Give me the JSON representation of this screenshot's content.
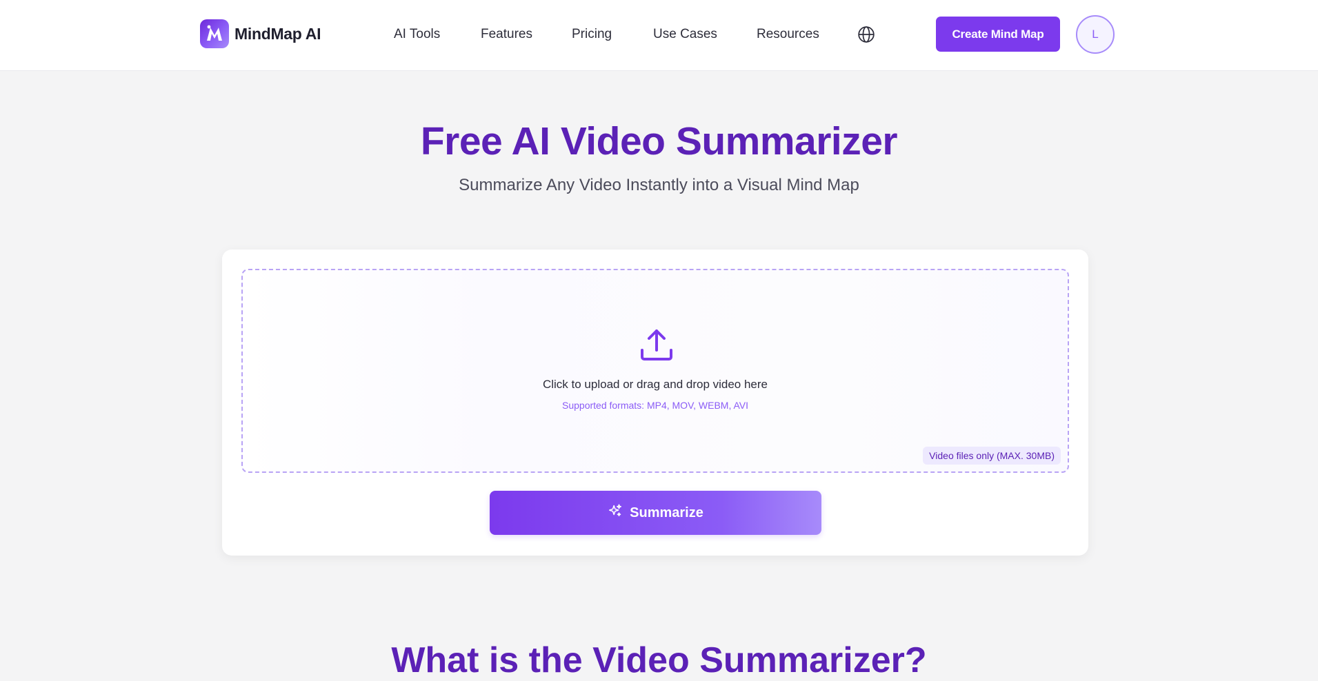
{
  "header": {
    "logo_text": "MindMap AI",
    "nav": [
      "AI Tools",
      "Features",
      "Pricing",
      "Use Cases",
      "Resources"
    ],
    "cta_label": "Create Mind Map",
    "avatar_initial": "L",
    "icons": {
      "globe": "globe-icon"
    }
  },
  "hero": {
    "title": "Free AI Video Summarizer",
    "subtitle": "Summarize Any Video Instantly into a Visual Mind Map"
  },
  "upload": {
    "prompt": "Click to upload or drag and drop video here",
    "formats": "Supported formats: MP4, MOV, WEBM, AVI",
    "limit": "Video files only (MAX. 30MB)",
    "button_label": "Summarize",
    "icons": {
      "upload": "upload-icon",
      "button": "sparkles-icon"
    }
  },
  "next_section": {
    "title": "What is the Video Summarizer?"
  },
  "colors": {
    "brand": "#7c3aed",
    "title": "#5b21b6",
    "background": "#f4f4f5"
  }
}
